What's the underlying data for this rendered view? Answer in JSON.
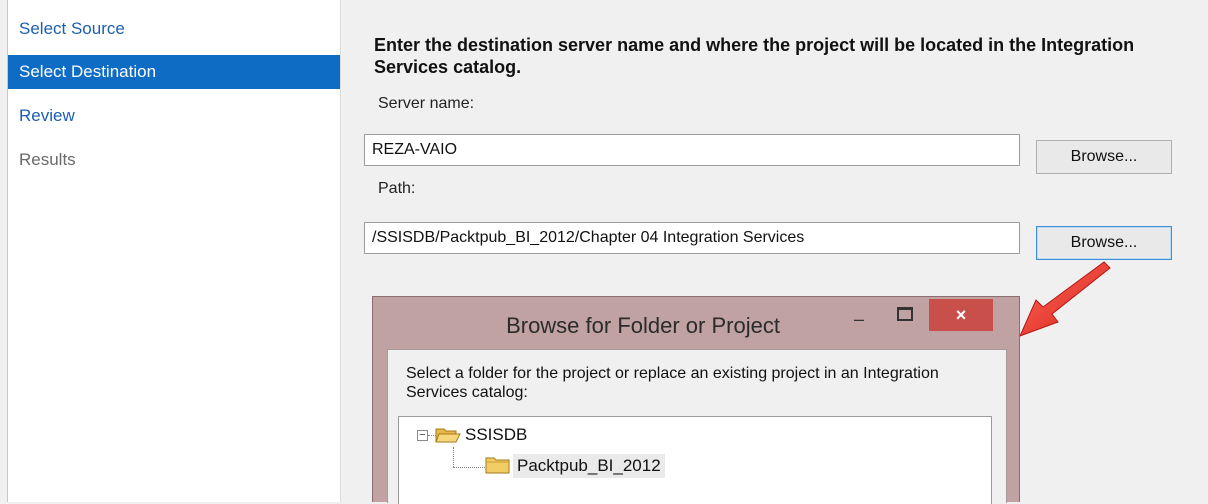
{
  "nav": {
    "items": [
      {
        "label": "Select Source",
        "state": "link"
      },
      {
        "label": "Select Destination",
        "state": "selected"
      },
      {
        "label": "Review",
        "state": "link"
      },
      {
        "label": "Results",
        "state": "disabled"
      }
    ]
  },
  "main": {
    "heading": "Enter the destination server name and where the project will be located in the Integration Services catalog.",
    "server_label": "Server name:",
    "server_value": "REZA-VAIO",
    "browse_label": "Browse...",
    "path_label": "Path:",
    "path_value": "/SSISDB/Packtpub_BI_2012/Chapter 04 Integration Services"
  },
  "dialog": {
    "title": "Browse for Folder or Project",
    "minimize": "–",
    "close": "×",
    "instructions": "Select a folder for the project or replace an existing project in an Integration Services catalog:",
    "tree": {
      "expander": "−",
      "root": "SSISDB",
      "child": "Packtpub_BI_2012"
    }
  },
  "colors": {
    "selected_nav": "#0e6cc4",
    "link": "#1c5fb0",
    "dialog_frame": "#c1a2a2",
    "close_button": "#c9504a",
    "annotation_arrow": "#e8302a"
  },
  "icons": {
    "open_folder": "open-folder-icon",
    "folder": "folder-icon",
    "arrow": "red-pointer-arrow"
  }
}
